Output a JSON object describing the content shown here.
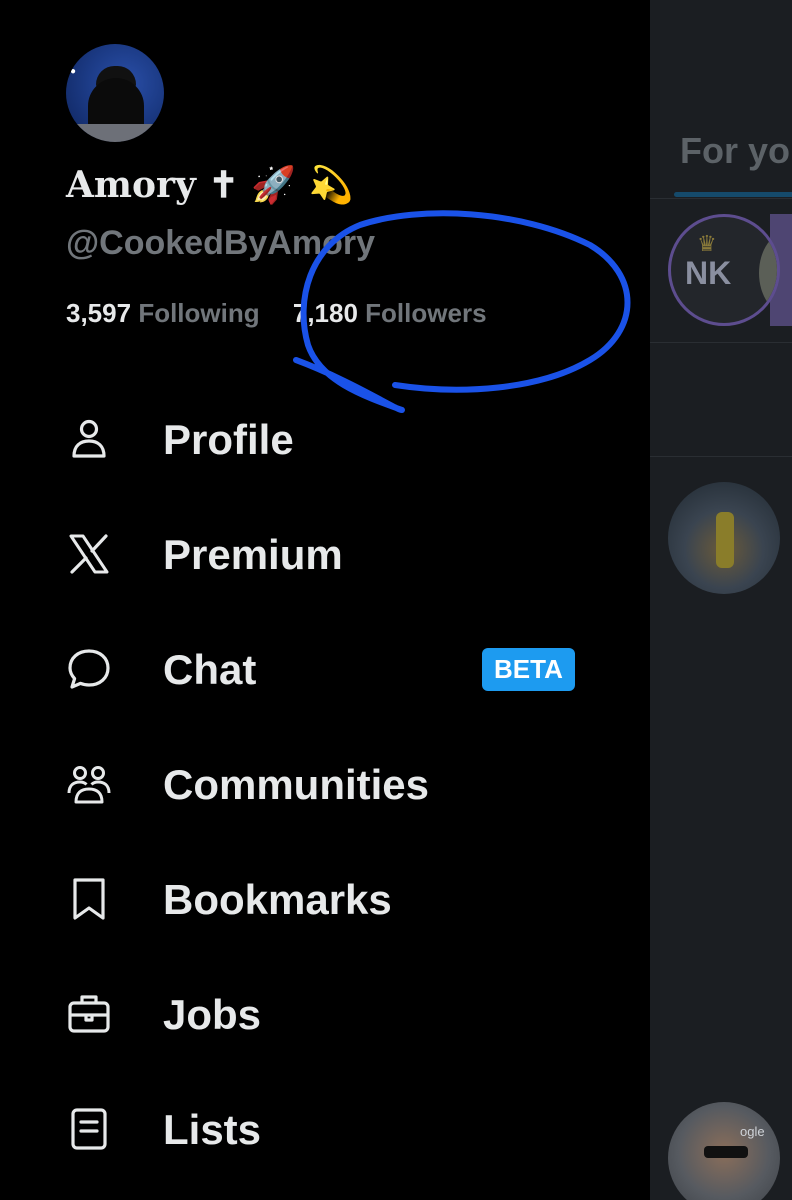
{
  "profile": {
    "name": "Amory ✝ 🚀 💫",
    "handle": "@CookedByAmory",
    "following_count": "3,597",
    "following_label": "Following",
    "followers_count": "7,180",
    "followers_label": "Followers"
  },
  "nav": {
    "items": [
      {
        "label": "Profile",
        "icon": "person-icon"
      },
      {
        "label": "Premium",
        "icon": "x-logo-icon"
      },
      {
        "label": "Chat",
        "icon": "chat-bubble-icon",
        "badge": "BETA"
      },
      {
        "label": "Communities",
        "icon": "communities-icon"
      },
      {
        "label": "Bookmarks",
        "icon": "bookmark-icon"
      },
      {
        "label": "Jobs",
        "icon": "briefcase-icon"
      },
      {
        "label": "Lists",
        "icon": "list-icon"
      }
    ]
  },
  "feed": {
    "tab_label": "For you",
    "avatar_texts": {
      "nk": "NK",
      "google": "ogle"
    }
  },
  "colors": {
    "background": "#000000",
    "feed_background": "#1b1e22",
    "text_primary": "#e7e9ea",
    "text_secondary": "#71767b",
    "badge_blue": "#1d9bf0",
    "annotation_blue": "#1a52e8"
  }
}
